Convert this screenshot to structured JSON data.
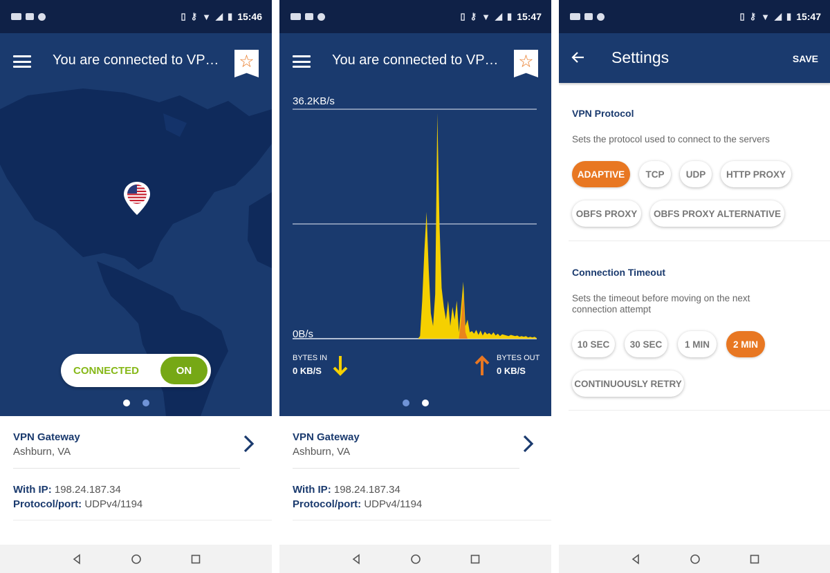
{
  "status": {
    "time1": "15:46",
    "time2": "15:47",
    "time3": "15:47"
  },
  "header": {
    "title": "You are connected to VP…"
  },
  "toggle": {
    "label": "CONNECTED",
    "state": "ON"
  },
  "gateway": {
    "title": "VPN Gateway",
    "location": "Ashburn, VA",
    "ip_label": "With IP:",
    "ip": "198.24.187.34",
    "protocol_label": "Protocol/port:",
    "protocol": "UDPv4/1194"
  },
  "chart_data": {
    "type": "area",
    "title": "",
    "y_max_label": "36.2KB/s",
    "y_min_label": "0B/s",
    "ylim": [
      0,
      36.2
    ],
    "unit": "KB/s",
    "series": [
      {
        "name": "BYTES IN",
        "color": "#f5d000",
        "values": [
          0,
          0,
          0,
          0,
          0,
          0,
          0,
          0,
          0,
          0,
          0,
          0,
          0,
          0,
          0,
          0,
          0,
          0,
          0,
          0,
          0,
          0,
          0,
          0,
          0,
          0,
          0,
          0,
          0,
          0,
          0,
          0,
          0,
          0,
          0,
          0,
          0,
          0,
          0,
          0,
          0,
          0,
          0,
          0,
          0,
          0,
          0,
          0,
          0,
          0,
          0,
          0,
          0,
          0,
          0,
          0,
          0,
          0,
          0,
          0.4,
          6,
          14,
          20,
          11,
          4,
          2,
          7,
          35.6,
          18,
          8,
          5,
          3,
          6,
          2,
          5,
          3,
          6,
          1,
          5,
          9,
          2,
          3,
          1,
          1.2,
          0.8,
          1.4,
          0.6,
          1.3,
          0.5,
          1.1,
          0.7,
          0.9,
          0.6,
          1.0,
          0.5,
          0.8,
          0.4,
          0.7,
          0.6,
          0.5,
          0.4,
          0.6,
          0.5,
          0.4,
          0.5,
          0.3,
          0.4,
          0.3,
          0.4,
          0.2,
          0.3,
          0.2,
          0.3,
          0.1
        ]
      },
      {
        "name": "BYTES OUT",
        "color": "#e87722",
        "values": [
          0,
          0,
          0,
          0,
          0,
          0,
          0,
          0,
          0,
          0,
          0,
          0,
          0,
          0,
          0,
          0,
          0,
          0,
          0,
          0,
          0,
          0,
          0,
          0,
          0,
          0,
          0,
          0,
          0,
          0,
          0,
          0,
          0,
          0,
          0,
          0,
          0,
          0,
          0,
          0,
          0,
          0,
          0,
          0,
          0,
          0,
          0,
          0,
          0,
          0,
          0,
          0,
          0,
          0,
          0,
          0,
          0,
          0,
          0,
          0,
          0,
          0,
          0,
          0,
          0,
          0,
          0,
          0,
          0,
          0,
          0,
          0,
          0,
          0,
          0,
          0,
          0,
          0,
          3,
          7,
          1,
          0,
          0,
          0,
          0,
          0,
          0,
          0,
          0,
          0,
          0,
          0,
          0,
          0,
          0,
          0,
          0,
          0,
          0,
          0,
          0,
          0,
          0,
          0,
          0,
          0,
          0,
          0,
          0,
          0,
          0,
          0,
          0,
          0
        ]
      }
    ],
    "grid": true
  },
  "bytes": {
    "in_label": "BYTES IN",
    "in_value": "0 KB/S",
    "out_label": "BYTES OUT",
    "out_value": "0 KB/S"
  },
  "settings": {
    "title": "Settings",
    "save": "SAVE",
    "protocol_title": "VPN Protocol",
    "protocol_desc": "Sets the protocol used to connect to the servers",
    "protocols": [
      "ADAPTIVE",
      "TCP",
      "UDP",
      "HTTP PROXY",
      "OBFS PROXY",
      "OBFS PROXY ALTERNATIVE"
    ],
    "timeout_title": "Connection Timeout",
    "timeout_desc": "Sets the timeout before moving on the next connection attempt",
    "timeouts": [
      "10 SEC",
      "30 SEC",
      "1 MIN",
      "2 MIN",
      "CONTINUOUSLY RETRY"
    ]
  },
  "colors": {
    "navy": "#0f2147",
    "blue": "#1a3a6e",
    "orange": "#e87722",
    "green": "#76a815",
    "yellow": "#f5d000"
  }
}
